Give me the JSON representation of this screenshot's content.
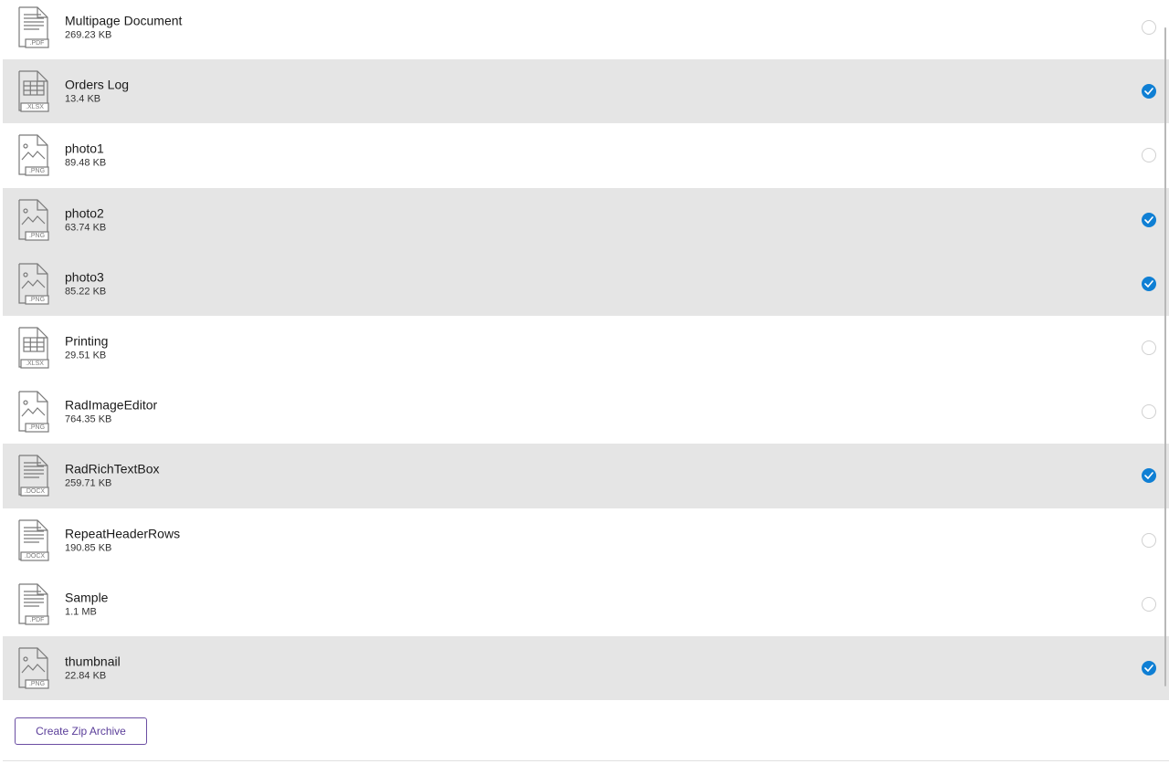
{
  "files": [
    {
      "name": "Multipage Document",
      "size": "269.23 KB",
      "type": "PDF",
      "icon": "pdf-file-icon",
      "selected": false
    },
    {
      "name": "Orders Log",
      "size": "13.4 KB",
      "type": "XLSX",
      "icon": "xlsx-file-icon",
      "selected": true
    },
    {
      "name": "photo1",
      "size": "89.48 KB",
      "type": "PNG",
      "icon": "png-file-icon",
      "selected": false
    },
    {
      "name": "photo2",
      "size": "63.74 KB",
      "type": "PNG",
      "icon": "png-file-icon",
      "selected": true
    },
    {
      "name": "photo3",
      "size": "85.22 KB",
      "type": "PNG",
      "icon": "png-file-icon",
      "selected": true
    },
    {
      "name": "Printing",
      "size": "29.51 KB",
      "type": "XLSX",
      "icon": "xlsx-file-icon",
      "selected": false
    },
    {
      "name": "RadImageEditor",
      "size": "764.35 KB",
      "type": "PNG",
      "icon": "png-file-icon",
      "selected": false
    },
    {
      "name": "RadRichTextBox",
      "size": "259.71 KB",
      "type": "DOCX",
      "icon": "docx-file-icon",
      "selected": true
    },
    {
      "name": "RepeatHeaderRows",
      "size": "190.85 KB",
      "type": "DOCX",
      "icon": "docx-file-icon",
      "selected": false
    },
    {
      "name": "Sample",
      "size": "1.1 MB",
      "type": "PDF",
      "icon": "pdf-file-icon",
      "selected": false
    },
    {
      "name": "thumbnail",
      "size": "22.84 KB",
      "type": "PNG",
      "icon": "png-file-icon",
      "selected": true
    }
  ],
  "footer": {
    "zip_button_label": "Create Zip Archive"
  },
  "colors": {
    "selected_row_bg": "#e5e5e5",
    "checked_radio": "#0f7fd4",
    "button_border": "#6b4ea3",
    "button_text": "#5a3d99"
  }
}
